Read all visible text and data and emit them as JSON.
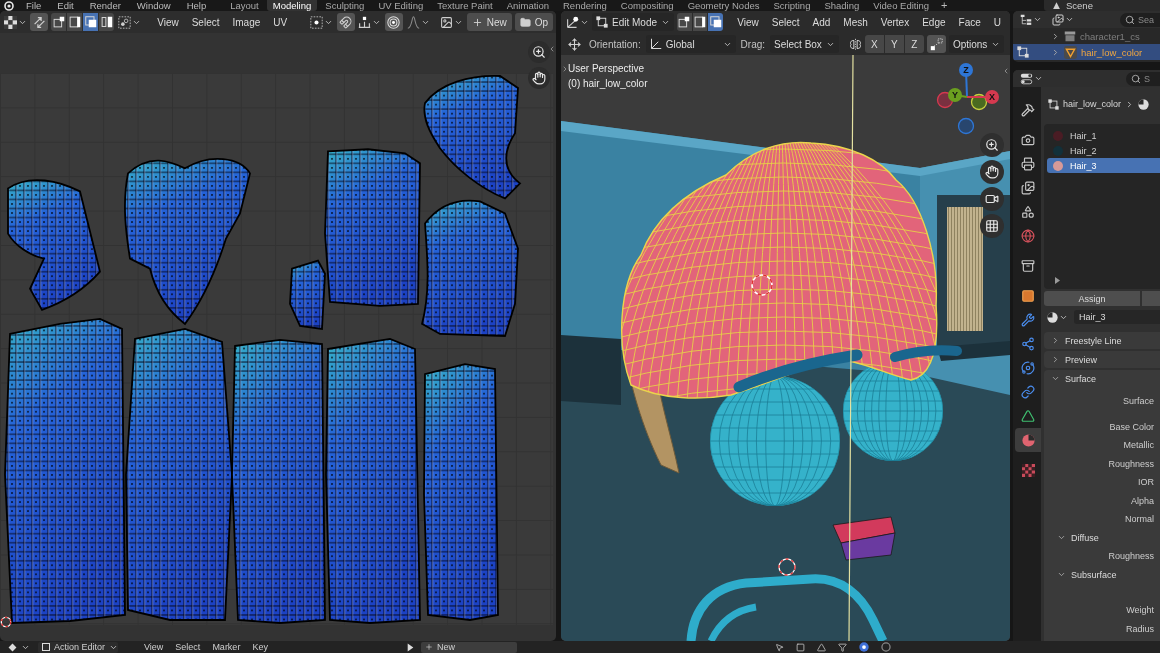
{
  "top_bar": {
    "menus": [
      "File",
      "Edit",
      "Render",
      "Window",
      "Help"
    ],
    "workspaces": [
      {
        "label": "Layout",
        "selected": false
      },
      {
        "label": "Modeling",
        "selected": true
      },
      {
        "label": "Sculpting",
        "selected": false
      },
      {
        "label": "UV Editing",
        "selected": false
      },
      {
        "label": "Texture Paint",
        "selected": false
      },
      {
        "label": "Animation",
        "selected": false
      },
      {
        "label": "Rendering",
        "selected": false
      },
      {
        "label": "Compositing",
        "selected": false
      },
      {
        "label": "Geometry Nodes",
        "selected": false
      },
      {
        "label": "Scripting",
        "selected": false
      },
      {
        "label": "Shading",
        "selected": false
      },
      {
        "label": "Video Editing",
        "selected": false
      }
    ],
    "add_workspace": "+",
    "scene": "Scene"
  },
  "uv_editor": {
    "select_modes": [
      {
        "kind": "vertex",
        "selected": false
      },
      {
        "kind": "edge",
        "selected": false
      },
      {
        "kind": "face",
        "selected": true
      },
      {
        "kind": "island",
        "selected": false
      }
    ],
    "menus": [
      "View",
      "Select",
      "Image",
      "UV"
    ],
    "snap": true,
    "proportional_editing": true,
    "new_button": "New",
    "open_button": "Op"
  },
  "viewport": {
    "mode": "Edit Mode",
    "select_modes": [
      {
        "kind": "vertex",
        "selected": false
      },
      {
        "kind": "edge",
        "selected": false
      },
      {
        "kind": "face",
        "selected": true
      }
    ],
    "menus": [
      "View",
      "Select",
      "Add",
      "Mesh",
      "Vertex",
      "Edge",
      "Face",
      "U"
    ],
    "orientation_label": "Orientation:",
    "orientation": "Global",
    "drag_label": "Drag:",
    "drag": "Select Box",
    "mirror_axes": [
      "X",
      "Y",
      "Z"
    ],
    "options": "Options",
    "view_name": "User Perspective",
    "object_name": "(0) hair_low_color",
    "gizmo_axes": [
      "Z",
      "Y",
      "X"
    ]
  },
  "outliner": {
    "search_placeholder": "Sea",
    "rows": [
      {
        "kind": "collection",
        "label": "character1_cs",
        "expanded": false,
        "edit_mode": false,
        "selected": false,
        "disabled": true
      },
      {
        "kind": "mesh",
        "label": "hair_low_color",
        "expanded": false,
        "edit_mode": true,
        "selected": true,
        "disabled": false
      }
    ]
  },
  "properties": {
    "search_placeholder": "S",
    "tab_groups": [
      [
        {
          "kind": "tool",
          "selected": false
        }
      ],
      [
        {
          "kind": "render",
          "selected": false
        },
        {
          "kind": "output",
          "selected": false
        },
        {
          "kind": "view_layer",
          "selected": false
        },
        {
          "kind": "scene",
          "selected": false
        },
        {
          "kind": "world",
          "selected": false
        }
      ],
      [
        {
          "kind": "collection",
          "selected": false
        }
      ],
      [
        {
          "kind": "object",
          "selected": false
        },
        {
          "kind": "modifiers",
          "selected": false
        },
        {
          "kind": "particles",
          "selected": false
        },
        {
          "kind": "physics",
          "selected": false
        },
        {
          "kind": "constraints",
          "selected": false
        },
        {
          "kind": "data",
          "selected": false
        },
        {
          "kind": "material",
          "selected": true
        }
      ],
      [
        {
          "kind": "texture",
          "selected": false
        }
      ]
    ],
    "breadcrumb": "hair_low_color",
    "materials": [
      {
        "name": "Hair_1",
        "color": "#4a1c24",
        "selected": false
      },
      {
        "name": "Hair_2",
        "color": "#12303a",
        "selected": false
      },
      {
        "name": "Hair_3",
        "color": "#d89a98",
        "selected": true
      }
    ],
    "assign_button": "Assign",
    "active_material": "Hair_3",
    "panels": [
      {
        "title": "Freestyle Line",
        "expanded": false
      },
      {
        "title": "Preview",
        "expanded": false
      },
      {
        "title": "Surface",
        "expanded": true,
        "rows": [
          "Surface",
          "Base Color",
          "Metallic",
          "Roughness",
          "IOR",
          "Alpha",
          "Normal"
        ],
        "subpanels": [
          {
            "title": "Diffuse",
            "expanded": true,
            "rows": [
              "Roughness"
            ]
          },
          {
            "title": "Subsurface",
            "expanded": true,
            "rows": [
              "Weight",
              "Radius"
            ]
          }
        ]
      }
    ]
  },
  "bottom_bar": {
    "editor": "Action Editor",
    "menus": [
      "View",
      "Select",
      "Marker",
      "Key"
    ],
    "new_button": "New"
  }
}
